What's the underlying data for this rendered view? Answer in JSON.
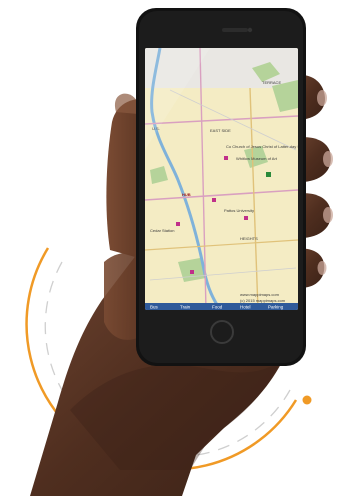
{
  "map": {
    "labels": {
      "usa": "U.S.",
      "church": "Co Church of Jesus Christ of Latter-day Saints",
      "museum": "Whitlow Museum of Art",
      "east_side": "EAST SIDE",
      "university": "Pattos University",
      "terrace": "TERRACE",
      "hub": "HUB",
      "station": "Cedar Station",
      "heights": "HEIGHTS",
      "watermark": "www.mappimaps.com",
      "copyright": "(c) 2015 mappimaps.com"
    },
    "bottom_bar": [
      "Bus",
      "Train",
      "Food",
      "Hotel",
      "Parking"
    ]
  },
  "colors": {
    "map_background": "#f4ecc4",
    "park_green": "#b5d39a",
    "river_blue": "#7fb2da",
    "road_pink": "#d9a0c0",
    "bottom_bar": "#2f5a9a",
    "accent_orange": "#f09a26"
  }
}
